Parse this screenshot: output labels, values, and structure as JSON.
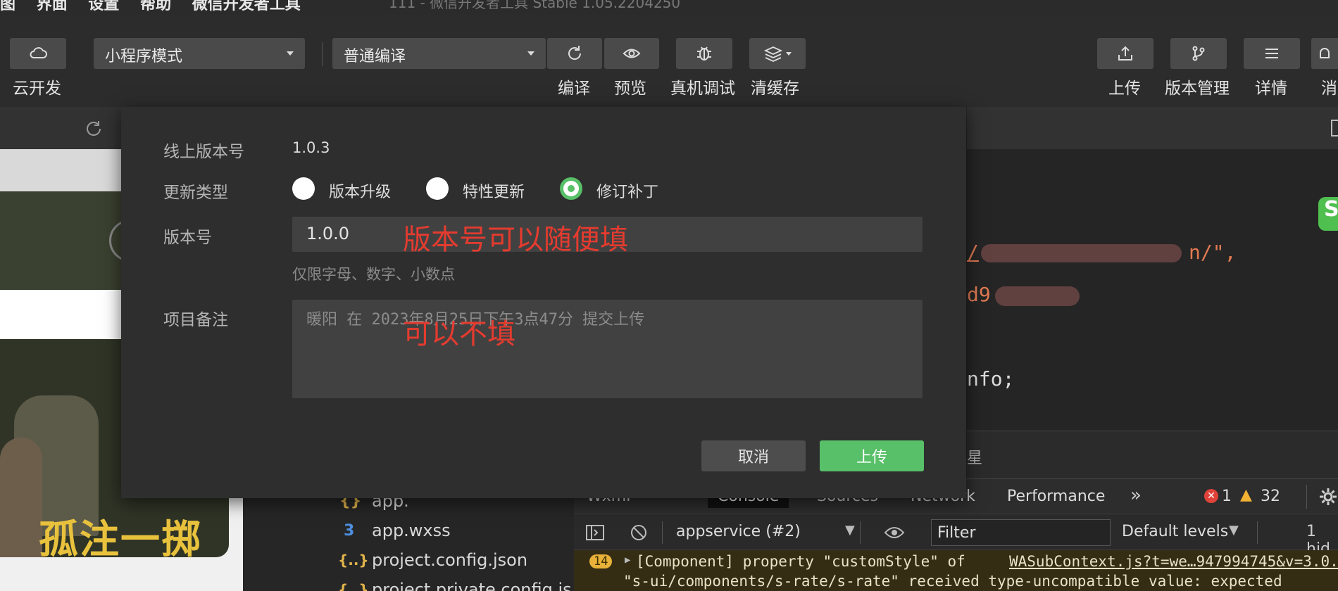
{
  "menubar": {
    "items": [
      "图",
      "界面",
      "设置",
      "帮助",
      "微信开发者工具"
    ],
    "window_title": "111 - 微信开发者工具 Stable 1.05.2204250"
  },
  "toolbar": {
    "cloud_label": "云开发",
    "mode_select": "小程序模式",
    "compile_select": "普通编译",
    "compile_label": "编译",
    "preview_label": "预览",
    "debug_label": "真机调试",
    "cache_label": "清缓存",
    "upload_label": "上传",
    "version_label": "版本管理",
    "details_label": "详情",
    "message_label": "消"
  },
  "simulator": {
    "poster_title": "孤注一掷"
  },
  "file_tree": {
    "items": [
      {
        "icon": "{}",
        "name": "app."
      },
      {
        "icon": "3",
        "name": "app.wxss"
      },
      {
        "icon": "{..}",
        "name": "project.config.json"
      },
      {
        "icon": "{..}",
        "name": "project.private.config.js..."
      }
    ]
  },
  "code": {
    "line1_a": "/",
    "line1_b": "n/\",",
    "line2": "d9",
    "line3": "nfo;",
    "panel_text": "星"
  },
  "devtools": {
    "tabs": [
      "Wxml",
      "Console",
      "Sources",
      "Network",
      "Performance"
    ],
    "more": "»",
    "error_count": "1",
    "warning_count": "32",
    "context_select": "appservice (#2)",
    "filter_placeholder": "Filter",
    "levels_select": "Default levels",
    "hidden_text": "1 hid",
    "console_count": "14",
    "console_line1": "[Component] property \"customStyle\" of",
    "console_link": "WASubContext.js?t=we…947994745&v=3.0.",
    "console_line2": "\"s-ui/components/s-rate/s-rate\" received type-uncompatible value: expected"
  },
  "modal": {
    "online_version_label": "线上版本号",
    "online_version_value": "1.0.3",
    "update_type_label": "更新类型",
    "update_options": [
      {
        "label": "版本升级",
        "selected": false
      },
      {
        "label": "特性更新",
        "selected": false
      },
      {
        "label": "修订补丁",
        "selected": true
      }
    ],
    "version_label": "版本号",
    "version_value": "1.0.0",
    "version_hint": "仅限字母、数字、小数点",
    "note_label": "项目备注",
    "note_placeholder": "暖阳 在 2023年8月25日下午3点47分 提交上传",
    "annotation_version": "版本号可以随便填",
    "annotation_note": "可以不填",
    "cancel_button": "取消",
    "upload_button": "上传",
    "accent_color": "#58c068",
    "annotation_color": "#e53b2f"
  }
}
